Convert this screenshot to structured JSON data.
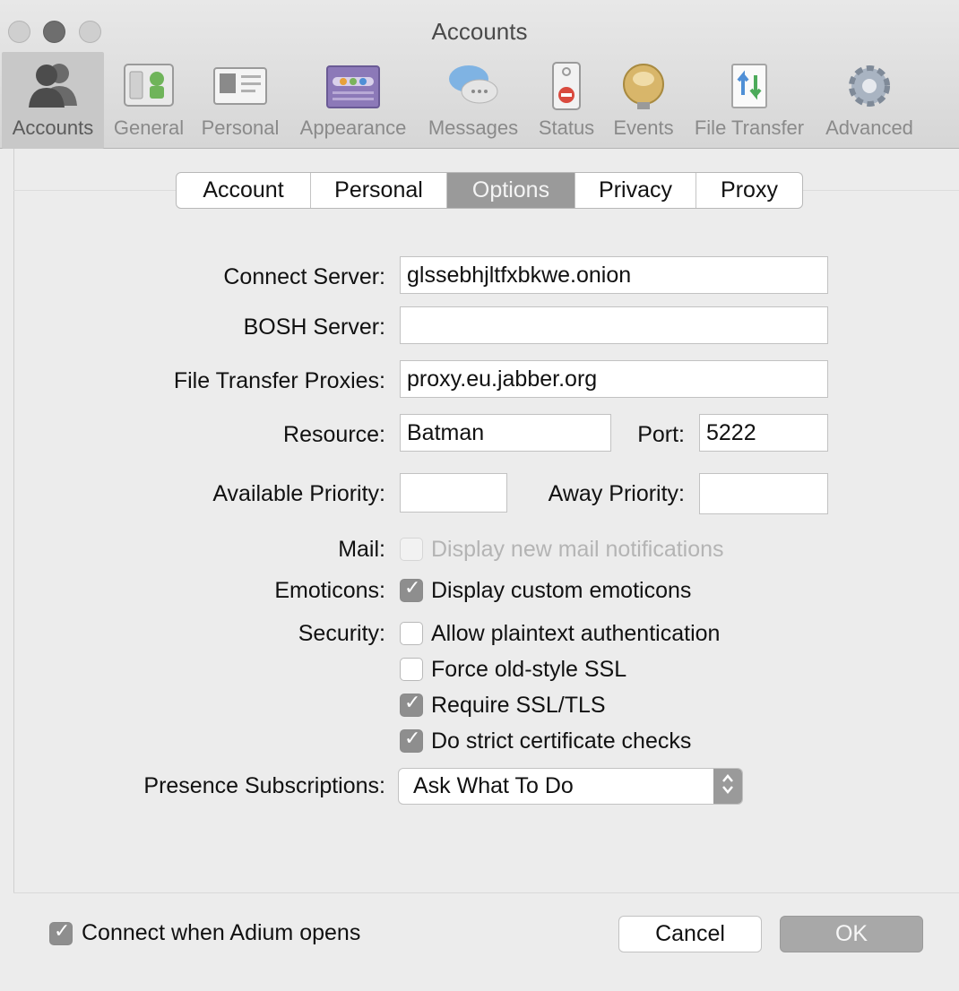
{
  "window": {
    "title": "Accounts"
  },
  "toolbar": {
    "items": [
      {
        "label": "Accounts",
        "icon": "people-icon",
        "selected": true
      },
      {
        "label": "General",
        "icon": "general-switch-icon"
      },
      {
        "label": "Personal",
        "icon": "id-card-icon"
      },
      {
        "label": "Appearance",
        "icon": "palette-window-icon"
      },
      {
        "label": "Messages",
        "icon": "speech-bubbles-icon"
      },
      {
        "label": "Status",
        "icon": "status-sign-icon"
      },
      {
        "label": "Events",
        "icon": "bell-icon"
      },
      {
        "label": "File Transfer",
        "icon": "transfer-arrows-icon"
      },
      {
        "label": "Advanced",
        "icon": "gear-icon"
      }
    ]
  },
  "tabs": {
    "items": [
      "Account",
      "Personal",
      "Options",
      "Privacy",
      "Proxy"
    ],
    "active": "Options"
  },
  "form": {
    "connect_server_label": "Connect Server:",
    "connect_server_value": "glssebhjltfxbkwe.onion",
    "bosh_server_label": "BOSH Server:",
    "bosh_server_value": "",
    "file_transfer_proxies_label": "File Transfer Proxies:",
    "file_transfer_proxies_value": "proxy.eu.jabber.org",
    "resource_label": "Resource:",
    "resource_value": "Batman",
    "port_label": "Port:",
    "port_value": "5222",
    "available_priority_label": "Available Priority:",
    "available_priority_value": "",
    "away_priority_label": "Away Priority:",
    "away_priority_value": "",
    "mail_label": "Mail:",
    "mail_checkbox": {
      "label": "Display new mail notifications",
      "checked": false,
      "disabled": true
    },
    "emoticons_label": "Emoticons:",
    "emoticons_checkbox": {
      "label": "Display custom emoticons",
      "checked": true
    },
    "security_label": "Security:",
    "security_checkboxes": [
      {
        "label": "Allow plaintext authentication",
        "checked": false
      },
      {
        "label": "Force old-style SSL",
        "checked": false
      },
      {
        "label": "Require SSL/TLS",
        "checked": true
      },
      {
        "label": "Do strict certificate checks",
        "checked": true
      }
    ],
    "presence_label": "Presence Subscriptions:",
    "presence_value": "Ask What To Do"
  },
  "footer": {
    "connect_checkbox": {
      "label": "Connect when Adium opens",
      "checked": true
    },
    "cancel_label": "Cancel",
    "ok_label": "OK"
  },
  "check_glyph": "✓",
  "stepper_glyph": "⌃⌄"
}
